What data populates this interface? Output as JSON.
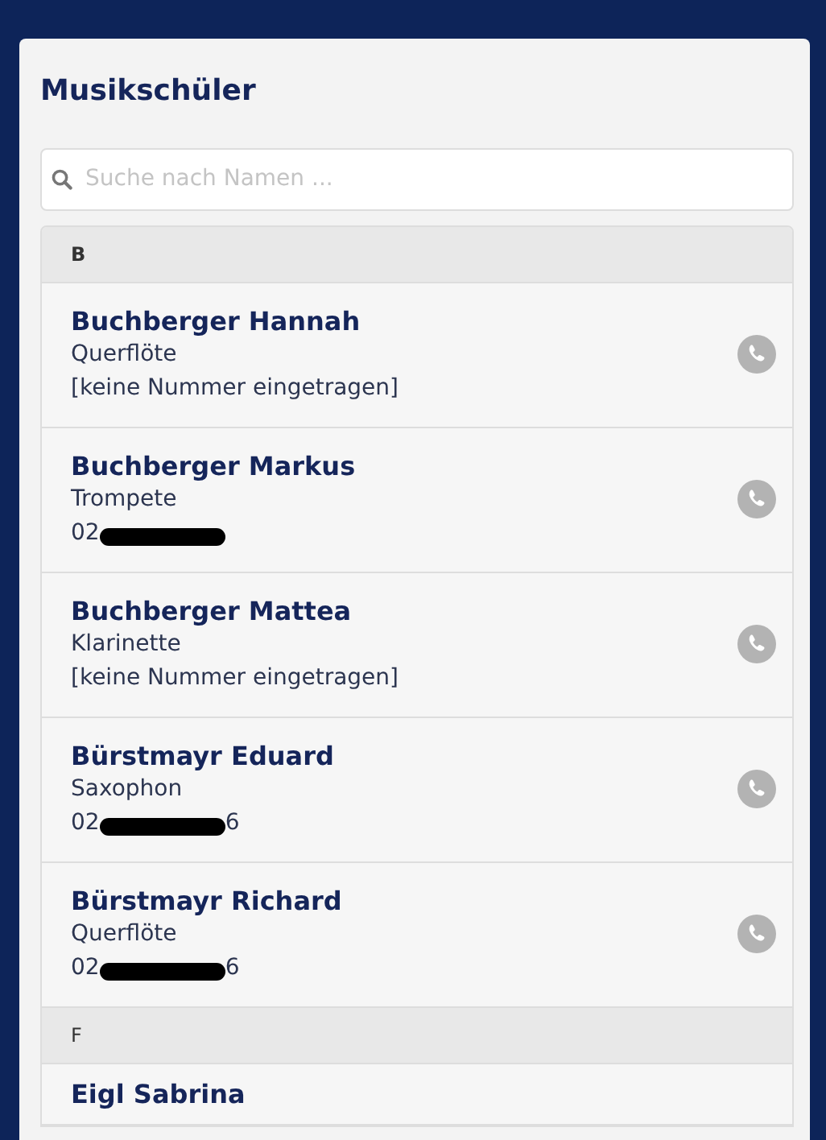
{
  "title": "Musikschüler",
  "search": {
    "placeholder": "Suche nach Namen ..."
  },
  "groups": [
    {
      "letter": "B",
      "students": [
        {
          "name": "Buchberger Hannah",
          "instrument": "Querflöte",
          "phone": {
            "kind": "text",
            "text": "[keine Nummer eingetragen]"
          }
        },
        {
          "name": "Buchberger Markus",
          "instrument": "Trompete",
          "phone": {
            "kind": "redacted",
            "prefix": "02"
          }
        },
        {
          "name": "Buchberger Mattea",
          "instrument": "Klarinette",
          "phone": {
            "kind": "text",
            "text": "[keine Nummer eingetragen]"
          }
        },
        {
          "name": "Bürstmayr Eduard",
          "instrument": "Saxophon",
          "phone": {
            "kind": "redacted",
            "prefix": "02",
            "suffix": "6"
          }
        },
        {
          "name": "Bürstmayr Richard",
          "instrument": "Querflöte",
          "phone": {
            "kind": "redacted",
            "prefix": "02",
            "suffix": "6"
          }
        }
      ]
    },
    {
      "letter": "F",
      "students": [
        {
          "name": "Eigl Sabrina"
        }
      ]
    }
  ]
}
